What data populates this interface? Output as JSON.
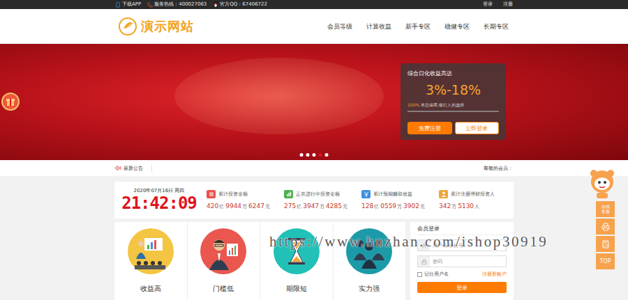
{
  "topbar": {
    "items": [
      {
        "kind": "app",
        "label": "下载APP"
      },
      {
        "kind": "phone",
        "label": "服务热线：400027063"
      },
      {
        "kind": "qq",
        "label": "官方QQ：67406722"
      }
    ],
    "links": [
      "登录",
      "注册"
    ]
  },
  "header": {
    "logo": "演示网站",
    "nav": [
      "会员等级",
      "计算收益",
      "新手专区",
      "稳健专区",
      "长期专区"
    ]
  },
  "banner": {
    "dots": [
      {
        "selected": false
      },
      {
        "selected": false
      },
      {
        "selected": false
      },
      {
        "selected": true
      },
      {
        "selected": false
      }
    ]
  },
  "promo": {
    "title": "综合日化收益高达",
    "rate": "3%-18%",
    "percent": "100%",
    "slogan": "本息保障,银行人的选择",
    "buttons": [
      {
        "label": "免费注册",
        "kind": "primary"
      },
      {
        "label": "立即登录",
        "kind": "outline"
      }
    ]
  },
  "notice": {
    "label": "最新公告",
    "message": "尊敬的会员："
  },
  "stats": {
    "date": "2020年07月16日 周四",
    "clock": "21:42:09",
    "items": [
      {
        "label": "累计投资金额",
        "kind": "list",
        "color": "#e8534a",
        "parts": [
          {
            "value": "420",
            "unit": "亿"
          },
          {
            "value": "9944",
            "unit": "万"
          },
          {
            "value": "6247",
            "unit": "元"
          }
        ]
      },
      {
        "label": "正在进行中投资金额",
        "kind": "bars",
        "color": "#4cb050",
        "parts": [
          {
            "value": "275",
            "unit": "亿"
          },
          {
            "value": "3947",
            "unit": "万"
          },
          {
            "value": "4285",
            "unit": "元"
          }
        ]
      },
      {
        "label": "累计预期赚取收益",
        "kind": "yen",
        "color": "#3d8fe0",
        "parts": [
          {
            "value": "128",
            "unit": "亿"
          },
          {
            "value": "0559",
            "unit": "万"
          },
          {
            "value": "3902",
            "unit": "元"
          }
        ]
      },
      {
        "label": "累计注册理财投资人",
        "kind": "user",
        "color": "#f0a53a",
        "parts": [
          {
            "value": "342",
            "unit": "万"
          },
          {
            "value": "5130",
            "unit": "人"
          }
        ]
      }
    ]
  },
  "features": [
    {
      "label": "收益高",
      "kind": "chart",
      "color": "#f4c542"
    },
    {
      "label": "门槛低",
      "kind": "presenter",
      "color": "#e9574f"
    },
    {
      "label": "期限短",
      "kind": "hourglass",
      "color": "#22c1b8"
    },
    {
      "label": "实力强",
      "kind": "team",
      "color": "#1d9aa8"
    }
  ],
  "login": {
    "title": "会员登录",
    "fields": [
      {
        "kind": "user",
        "placeholder": "用户名/手机号"
      },
      {
        "kind": "lock",
        "placeholder": "密码"
      }
    ],
    "remember": {
      "label": "记住用户名",
      "checked": false
    },
    "register": "注册新账户",
    "button": "登录"
  },
  "sidebar": {
    "service": "在线客服",
    "top": "TOP"
  },
  "watermark": "https://www.huzhan.com/ishop30919"
}
